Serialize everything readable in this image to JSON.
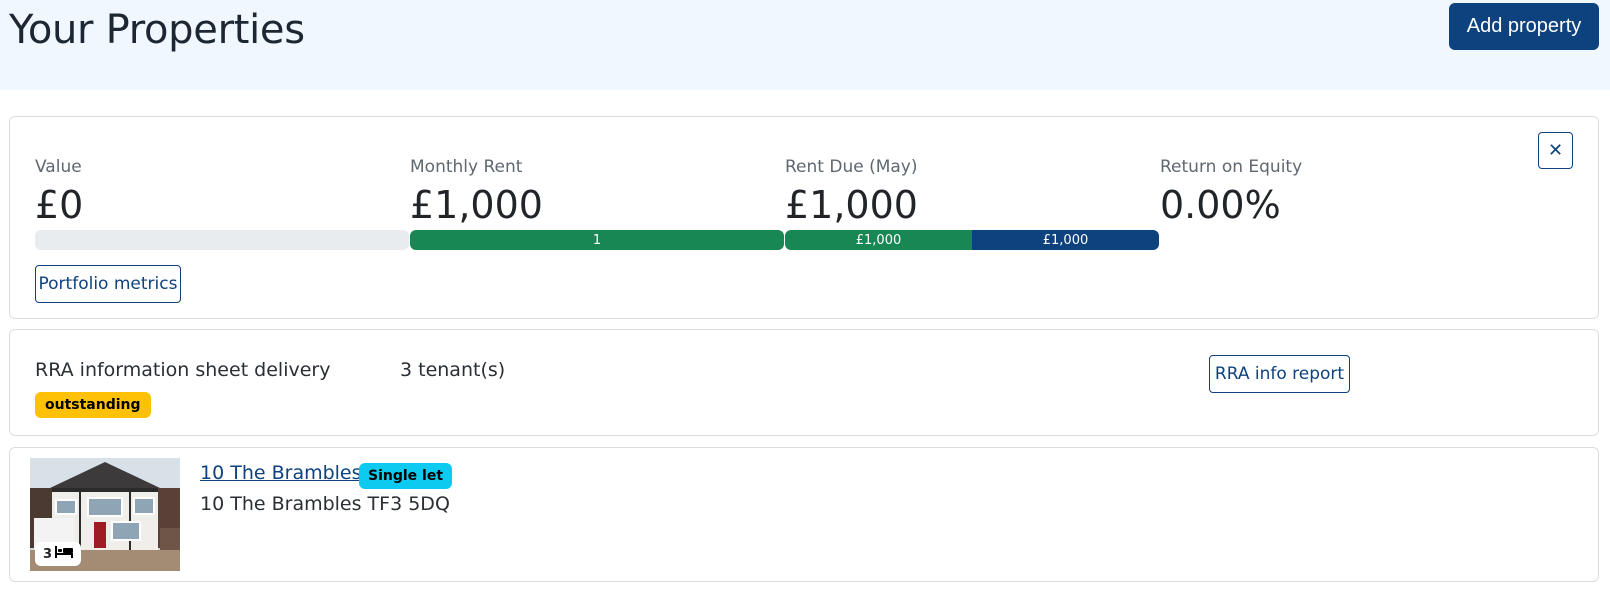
{
  "header": {
    "title": "Your Properties",
    "add_property_label": "Add property"
  },
  "metrics": {
    "close_label": "✕",
    "value": {
      "label": "Value",
      "amount": "£0",
      "progress": 0
    },
    "monthly_rent": {
      "label": "Monthly Rent",
      "amount": "£1,000",
      "bar_label": "1",
      "progress": 1.0
    },
    "rent_due": {
      "label": "Rent Due (May)",
      "amount": "£1,000",
      "paid_label": "£1,000",
      "due_label": "£1,000",
      "paid_fraction": 0.5,
      "due_fraction": 0.5
    },
    "return_on_equity": {
      "label": "Return on Equity",
      "amount": "0.00%"
    },
    "portfolio_metrics_label": "Portfolio metrics"
  },
  "rra": {
    "title": "RRA information sheet delivery",
    "status": "outstanding",
    "tenants": "3 tenant(s)",
    "report_label": "RRA info report"
  },
  "properties": [
    {
      "name": "10 The Brambles",
      "type": "Single let",
      "address": "10 The Brambles TF3 5DQ",
      "bedrooms": "3"
    }
  ],
  "colors": {
    "primary": "#0d427e",
    "success": "#198754",
    "warning": "#ffc107",
    "info": "#0dcaf0",
    "header_bg": "#f0f7ff"
  }
}
